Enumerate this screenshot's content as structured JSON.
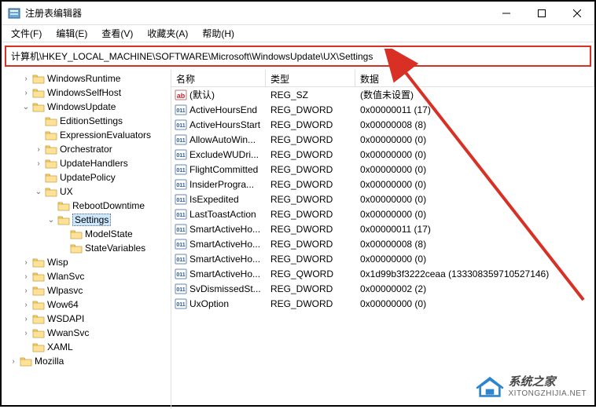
{
  "window": {
    "title": "注册表编辑器"
  },
  "menu": {
    "file": "文件(F)",
    "edit": "编辑(E)",
    "view": "查看(V)",
    "favorites": "收藏夹(A)",
    "help": "帮助(H)"
  },
  "address": {
    "path": "计算机\\HKEY_LOCAL_MACHINE\\SOFTWARE\\Microsoft\\WindowsUpdate\\UX\\Settings"
  },
  "tree": [
    {
      "depth": 1,
      "chev": ">",
      "label": "WindowsRuntime"
    },
    {
      "depth": 1,
      "chev": ">",
      "label": "WindowsSelfHost"
    },
    {
      "depth": 1,
      "chev": "v",
      "label": "WindowsUpdate"
    },
    {
      "depth": 2,
      "chev": "",
      "label": "EditionSettings"
    },
    {
      "depth": 2,
      "chev": "",
      "label": "ExpressionEvaluators"
    },
    {
      "depth": 2,
      "chev": ">",
      "label": "Orchestrator"
    },
    {
      "depth": 2,
      "chev": ">",
      "label": "UpdateHandlers"
    },
    {
      "depth": 2,
      "chev": "",
      "label": "UpdatePolicy"
    },
    {
      "depth": 2,
      "chev": "v",
      "label": "UX"
    },
    {
      "depth": 3,
      "chev": "",
      "label": "RebootDowntime"
    },
    {
      "depth": 3,
      "chev": "v",
      "label": "Settings",
      "selected": true
    },
    {
      "depth": 4,
      "chev": "",
      "label": "ModelState"
    },
    {
      "depth": 4,
      "chev": "",
      "label": "StateVariables"
    },
    {
      "depth": 1,
      "chev": ">",
      "label": "Wisp"
    },
    {
      "depth": 1,
      "chev": ">",
      "label": "WlanSvc"
    },
    {
      "depth": 1,
      "chev": ">",
      "label": "Wlpasvc"
    },
    {
      "depth": 1,
      "chev": ">",
      "label": "Wow64"
    },
    {
      "depth": 1,
      "chev": ">",
      "label": "WSDAPI"
    },
    {
      "depth": 1,
      "chev": ">",
      "label": "WwanSvc"
    },
    {
      "depth": 1,
      "chev": "",
      "label": "XAML"
    },
    {
      "depth": 0,
      "chev": ">",
      "label": "Mozilla"
    }
  ],
  "columns": {
    "name": "名称",
    "type": "类型",
    "data": "数据"
  },
  "values": [
    {
      "icon": "sz",
      "name": "(默认)",
      "type": "REG_SZ",
      "data": "(数值未设置)"
    },
    {
      "icon": "dw",
      "name": "ActiveHoursEnd",
      "type": "REG_DWORD",
      "data": "0x00000011 (17)"
    },
    {
      "icon": "dw",
      "name": "ActiveHoursStart",
      "type": "REG_DWORD",
      "data": "0x00000008 (8)"
    },
    {
      "icon": "dw",
      "name": "AllowAutoWin...",
      "type": "REG_DWORD",
      "data": "0x00000000 (0)"
    },
    {
      "icon": "dw",
      "name": "ExcludeWUDri...",
      "type": "REG_DWORD",
      "data": "0x00000000 (0)"
    },
    {
      "icon": "dw",
      "name": "FlightCommitted",
      "type": "REG_DWORD",
      "data": "0x00000000 (0)"
    },
    {
      "icon": "dw",
      "name": "InsiderProgra...",
      "type": "REG_DWORD",
      "data": "0x00000000 (0)"
    },
    {
      "icon": "dw",
      "name": "IsExpedited",
      "type": "REG_DWORD",
      "data": "0x00000000 (0)"
    },
    {
      "icon": "dw",
      "name": "LastToastAction",
      "type": "REG_DWORD",
      "data": "0x00000000 (0)"
    },
    {
      "icon": "dw",
      "name": "SmartActiveHo...",
      "type": "REG_DWORD",
      "data": "0x00000011 (17)"
    },
    {
      "icon": "dw",
      "name": "SmartActiveHo...",
      "type": "REG_DWORD",
      "data": "0x00000008 (8)"
    },
    {
      "icon": "dw",
      "name": "SmartActiveHo...",
      "type": "REG_DWORD",
      "data": "0x00000000 (0)"
    },
    {
      "icon": "dw",
      "name": "SmartActiveHo...",
      "type": "REG_QWORD",
      "data": "0x1d99b3f3222ceaa (133308359710527146)"
    },
    {
      "icon": "dw",
      "name": "SvDismissedSt...",
      "type": "REG_DWORD",
      "data": "0x00000002 (2)"
    },
    {
      "icon": "dw",
      "name": "UxOption",
      "type": "REG_DWORD",
      "data": "0x00000000 (0)"
    }
  ],
  "watermark": {
    "title": "系统之家",
    "url": "XITONGZHIJIA.NET"
  }
}
